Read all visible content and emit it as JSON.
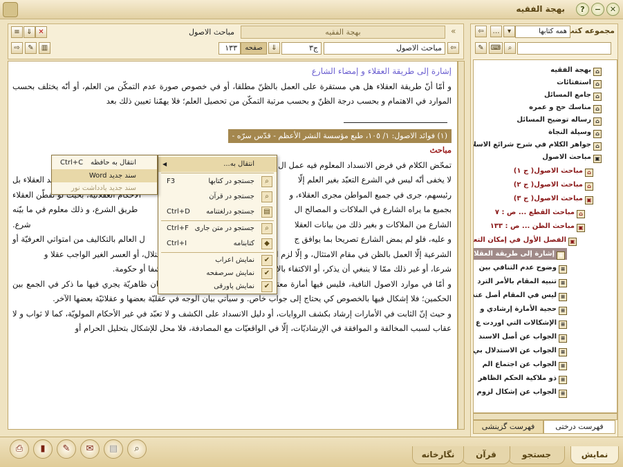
{
  "window": {
    "title": "بهجة الفقيه"
  },
  "left_pane": {
    "title": "مجموعه کتب",
    "dropdown_value": "همه کتابها",
    "search_value": "",
    "tree": [
      {
        "label": "بهجة الفقيه",
        "color": "#222"
      },
      {
        "label": "استفتائات",
        "color": "#222"
      },
      {
        "label": "جامع المسائل",
        "color": "#222"
      },
      {
        "label": "مناسك حج و عمره",
        "color": "#222"
      },
      {
        "label": "رساله توضيح المسائل",
        "color": "#222"
      },
      {
        "label": "وسيلة النجاة",
        "color": "#222"
      },
      {
        "label": "جواهر الكلام في شرح شرائع الاسلام",
        "color": "#222"
      },
      {
        "label": "مباحث الاصول",
        "color": "#222"
      },
      {
        "label": "مباحث الاصول( ج ١)",
        "color": "#8b1a1a"
      },
      {
        "label": "مباحث الاصول( ج ٢)",
        "color": "#8b1a1a"
      },
      {
        "label": "مباحث الاصول( ج ٣)",
        "color": "#8b1a1a"
      },
      {
        "label": "مباحث القطع ... ص : ٧",
        "color": "#8b1a1a"
      },
      {
        "label": "مباحث الظن ... ص : ١٣٣",
        "color": "#8b1a1a"
      },
      {
        "label": "الفصل الأول في إمكان التعبد",
        "color": "#8b1a1a"
      },
      {
        "label": "إشارة إلى طريقة العقلا",
        "color": "#ffffff"
      },
      {
        "label": "وضوح عدم التنافي بين",
        "color": "#222"
      },
      {
        "label": "تنبيه المقام بالأمر الترد",
        "color": "#222"
      },
      {
        "label": "ليس في المقام أصل عند",
        "color": "#222"
      },
      {
        "label": "حجية الأمارة إرشادي و",
        "color": "#222"
      },
      {
        "label": "الإشكالات التي اوردت ع",
        "color": "#222"
      },
      {
        "label": "الجواب عن أصل الاسند",
        "color": "#222"
      },
      {
        "label": "الجواب عن الاستدلال بي",
        "color": "#222"
      },
      {
        "label": "الجواب عن اجتماع الم",
        "color": "#222"
      },
      {
        "label": "ذو ملاكية الحكم الظاهر",
        "color": "#222"
      },
      {
        "label": "الجواب عن إشكال لزوم",
        "color": "#222"
      }
    ],
    "tabs": {
      "tree": "فهرست درختی",
      "selected": "فهرست گزینشی"
    }
  },
  "doc": {
    "tab_active": "بهجة الفقيه",
    "tab_right": "مباحث الاصول",
    "book_field": "مباحث الاصول",
    "volume_field": "ج٣",
    "page_label": "صفحه",
    "page_value": "١٣٣"
  },
  "content": {
    "heading": "إشارة إلى طريقة العقلاء و إمضاء الشارع",
    "p1": "و أمّا أنّ طريقة العقلاء هل هي مستقرة على العمل بالظنّ مطلقا، أو في خصوص صورة عدم التمكّن من العلم، أو أنّه يختلف بحسب الموارد في الاهتمام و بحسب درجة الظنّ و بحسب مرتبة التمكّن من تحصيل العلم؛ فلا يهمّنا تعيين ذلك بعد",
    "banner": "(١) فوائد الاصول: ١/ ١٠٥، طبع مؤسسة النشر الأعظم - قدّس سرّه -",
    "red": "مباحث",
    "p2a": "تمحّض الكلام في فرض الانسداد المعلوم فيه عمل ال",
    "p2b": "لا يخفى أنّه ليس في الشرع التعبّد بغير العلم إلّا",
    "p2c": "أمارات المعتبرة، كحيث إنّ أحد العقلاء بل",
    "p2d": "رئيسهم، جرى في جميع المواطن مجرى العقلاء، و",
    "p2e": "الأحكام العقلائيّة، بحيث لو تفطّن العقلاء",
    "p2f": "بجميع ما يراه الشارع في الملاكات و المصالح ال",
    "p2g": "طريق الشرع، و ذلك معلوم في ما بيّنه",
    "p2h": "الشارع من الملاكات و بغير ذلك من بيانات العقلا",
    "p2i": "شرع.",
    "p3a": "و عليه، فلو لم يمض الشارع تصريحا بما يوافق ج",
    "p3b": "ل العالم بالتكاليف من امتواتي العرفيّة أو",
    "p3c": "الشرعية إلّا العمل بالظن في مقام الامتثال، و إلّا لزم الإهمال أو الاحتياط التام الموجب للاختلال، أو العسر الغير الواجب عقلا و",
    "p3d": "شرعا، أو غير ذلك ممّا لا ينبغي أن يذكر، أو الاكتفاء بالامتثال الظنّي؛ و لازمه اعتبار الظنّ كشفا أو حكومة.",
    "p4": "و أمّا في موارد الاصول النافية، فليس فيها أمارة معتبرة عقلا و شرعا؛ و إنّما هي ترخيصان ظاهريّة يجري فيها ما ذكر في الجمع بين الحكمين؛ فلا إشكال فيها بالخصوص كي يحتاج إلى جواب خاص. و سيأتي بيان الوجه في عقليّة بعضها و عقلائيّة بعضها الآخر.",
    "p5": "و حيث إنّ الثابت في الأمارات إرشاد بكشف الروايات، أو دليل الانسداد على الكشف و لا تعبّد في غير الأحكام المولويّة، كما لا ثواب و لا عقاب لسبب المخالفة و الموافقة في الإرشاديّات، إلّا في الواقعيّات مع المصادفة، فلا محل للإشكال بتحليل الحرام أو"
  },
  "context_menu": {
    "items": [
      {
        "label": "انتقال به...",
        "shortcut": "",
        "icon": "",
        "checked": false
      },
      {
        "label": "جستجو در کتابها",
        "shortcut": "F3",
        "icon": "search-icon",
        "checked": false
      },
      {
        "label": "جستجو در قرآن",
        "shortcut": "",
        "icon": "search-icon",
        "checked": false
      },
      {
        "label": "جستجو درلغتنامه",
        "shortcut": "Ctrl+D",
        "icon": "dictionary-icon",
        "checked": false
      },
      {
        "label": "جستجو در متن جاری",
        "shortcut": "Ctrl+F",
        "icon": "search-icon",
        "checked": false
      },
      {
        "label": "كتابنامه",
        "shortcut": "Ctrl+I",
        "icon": "bookmark-icon",
        "checked": false
      },
      {
        "label": "نمايش اعراب",
        "shortcut": "",
        "icon": "check-icon",
        "checked": true
      },
      {
        "label": "نمايش سرصفحه",
        "shortcut": "",
        "icon": "check-icon",
        "checked": true
      },
      {
        "label": "نمايش پاورقی",
        "shortcut": "",
        "icon": "check-icon",
        "checked": true
      }
    ]
  },
  "submenu": {
    "items": [
      {
        "label": "انتقال به حافظه",
        "shortcut": "Ctrl+C"
      },
      {
        "label": "سند جديد Word",
        "shortcut": ""
      },
      {
        "label": "سند جديد يادداشت نور",
        "shortcut": "",
        "disabled": true
      }
    ]
  },
  "bottom_tabs": {
    "show": "نمايش",
    "search": "جستجو",
    "quran": "قرآن",
    "notes": "نگارخانه"
  }
}
